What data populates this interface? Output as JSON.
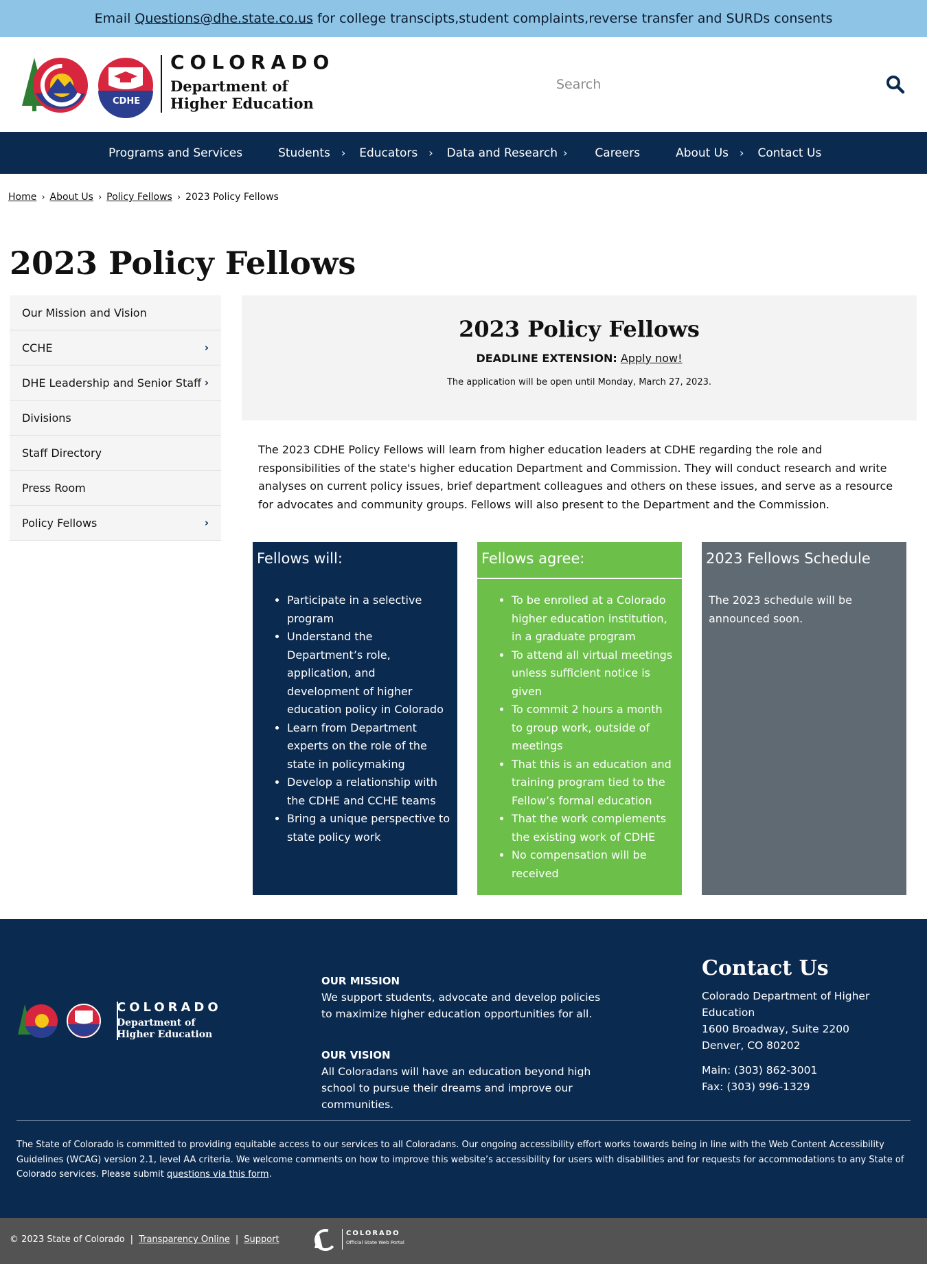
{
  "announcement": {
    "prefix": "Email",
    "email": "Questions@dhe.state.co.us",
    "suffix": "for college transcipts,student complaints,reverse transfer and SURDs consents"
  },
  "header": {
    "logo": {
      "badge": "CDHE",
      "state": "COLORADO",
      "dept_line1": "Department of",
      "dept_line2": "Higher Education"
    },
    "search": {
      "placeholder": "Search"
    }
  },
  "nav": {
    "items": [
      {
        "label": "Programs and Services",
        "has_children": false
      },
      {
        "label": "Students",
        "has_children": true
      },
      {
        "label": "Educators",
        "has_children": true
      },
      {
        "label": "Data and Research",
        "has_children": true
      },
      {
        "label": "Careers",
        "has_children": false
      },
      {
        "label": "About Us",
        "has_children": true
      },
      {
        "label": "Contact Us",
        "has_children": false
      }
    ]
  },
  "breadcrumb": {
    "items": [
      "Home",
      "About Us",
      "Policy Fellows"
    ],
    "current": "2023 Policy Fellows"
  },
  "page_title": "2023 Policy Fellows",
  "sidebar": {
    "items": [
      {
        "label": "Our Mission and Vision",
        "has_children": false
      },
      {
        "label": "CCHE",
        "has_children": true
      },
      {
        "label": "DHE Leadership and Senior Staff",
        "has_children": true
      },
      {
        "label": "Divisions",
        "has_children": false
      },
      {
        "label": "Staff Directory",
        "has_children": false
      },
      {
        "label": "Press Room",
        "has_children": false
      },
      {
        "label": "Policy Fellows",
        "has_children": true
      }
    ]
  },
  "hero": {
    "title": "2023 Policy Fellows",
    "deadline_label": "DEADLINE EXTENSION:",
    "deadline_link": "Apply now!",
    "note": "The application will be open until Monday, March 27, 2023."
  },
  "intro": "The 2023 CDHE Policy Fellows will learn from higher education leaders at CDHE regarding the role and responsibilities of the state's higher education Department and Commission. They will conduct research and write analyses on current policy issues, brief department colleagues and others on these issues, and serve as a resource for advocates and community groups. Fellows will also present to the Department and the Commission.",
  "columns": {
    "will": {
      "heading": "Fellows will:",
      "items": [
        "Participate in a selective program",
        "Understand the Department’s role, application, and development of higher education policy in Colorado",
        "Learn from Department experts on the role of the state in policymaking",
        "Develop a relationship with the CDHE and CCHE teams",
        "Bring a unique perspective to state policy work"
      ]
    },
    "agree": {
      "heading": "Fellows agree:",
      "items": [
        "To be enrolled at a Colorado higher education institution, in a graduate program",
        "To attend all virtual meetings unless sufficient notice is given",
        "To commit 2 hours a month to group work, outside of meetings",
        "That this is an education and training program tied to the Fellow’s formal education",
        "That the work complements the existing work of CDHE",
        "No compensation will be received"
      ]
    },
    "schedule": {
      "heading": "2023 Fellows Schedule",
      "body": "The 2023 schedule will be announced soon."
    }
  },
  "footer": {
    "mission_heading": "OUR MISSION",
    "mission_text": "We support students, advocate and develop policies to maximize higher education opportunities for all.",
    "vision_heading": "OUR VISION",
    "vision_text": "All Coloradans will have an education beyond high school to pursue their dreams and improve our communities.",
    "contact_heading": "Contact Us",
    "org": "Colorado Department of Higher Education",
    "address1": "1600 Broadway, Suite 2200",
    "address2": "Denver, CO 80202",
    "main": "Main: (303) 862-3001",
    "fax": "Fax: (303) 996-1329",
    "accessibility_text": "The State of Colorado is committed to providing equitable access to our services to all Coloradans. Our ongoing accessibility effort works towards being in line with the Web Content Accessibility Guidelines (WCAG) version 2.1, level AA criteria. We welcome comments on how to improve this website’s accessibility for users with disabilities and for requests for accommodations to any State of Colorado services. Please submit",
    "accessibility_link": "questions via this form",
    "accessibility_end": "."
  },
  "bottom_bar": {
    "copyright": "© 2023 State of Colorado",
    "transparency": "Transparency Online",
    "support": "Support",
    "portal_name": "COLORADO",
    "portal_sub": "Official State Web Portal"
  },
  "colors": {
    "announce_bg": "#8ec5e7",
    "navy": "#0b2a50",
    "green": "#6cc04a",
    "gray": "#5f6a73",
    "bottom_bg": "#535353"
  }
}
